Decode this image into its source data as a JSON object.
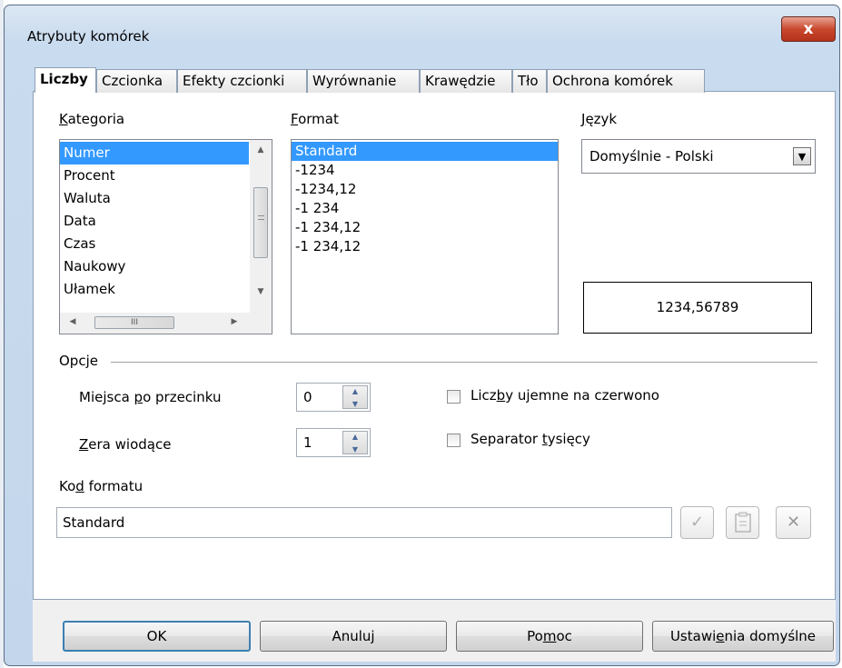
{
  "window": {
    "title": "Atrybuty komórek",
    "close_glyph": "x"
  },
  "tabs": [
    {
      "label": "Liczby",
      "active": true
    },
    {
      "label": "Czcionka"
    },
    {
      "label": "Efekty czcionki"
    },
    {
      "label": "Wyrównanie"
    },
    {
      "label": "Krawędzie"
    },
    {
      "label": "Tło"
    },
    {
      "label": "Ochrona komórek"
    }
  ],
  "category": {
    "label_pre": "",
    "label_acc": "K",
    "label_post": "ategoria",
    "items": [
      "Numer",
      "Procent",
      "Waluta",
      "Data",
      "Czas",
      "Naukowy",
      "Ułamek"
    ],
    "selected": "Numer",
    "scroll_glyph": "III"
  },
  "format": {
    "label_pre": "",
    "label_acc": "F",
    "label_post": "ormat",
    "items": [
      "Standard",
      "-1234",
      "-1234,12",
      "-1 234",
      "-1 234,12",
      "-1 234,12"
    ],
    "selected": "Standard"
  },
  "language": {
    "label_pre": "",
    "label_acc": "J",
    "label_post": "ęzyk",
    "value": "Domyślnie - Polski",
    "preview": "1234,56789"
  },
  "options": {
    "group_label": "Opcje",
    "decimals_label_pre": "Miejsca ",
    "decimals_label_acc": "p",
    "decimals_label_post": "o przecinku",
    "decimals_value": "0",
    "leading_label_pre": "",
    "leading_label_acc": "Z",
    "leading_label_post": "era wiodące",
    "leading_value": "1",
    "negative_red_pre": "Licz",
    "negative_red_acc": "b",
    "negative_red_post": "y ujemne na czerwono",
    "negative_red_checked": false,
    "thousands_pre": "Separator ",
    "thousands_acc": "t",
    "thousands_post": "ysięcy",
    "thousands_checked": false
  },
  "format_code": {
    "label_pre": "Ko",
    "label_acc": "d",
    "label_post": " formatu",
    "value": "Standard"
  },
  "buttons": {
    "ok": "OK",
    "cancel": "Anuluj",
    "help_pre": "Po",
    "help_acc": "m",
    "help_post": "oc",
    "defaults_pre": "Ustawi",
    "defaults_acc": "e",
    "defaults_post": "nia domyślne"
  },
  "colors": {
    "selection": "#3399ff",
    "frame": "#c9dbee"
  }
}
